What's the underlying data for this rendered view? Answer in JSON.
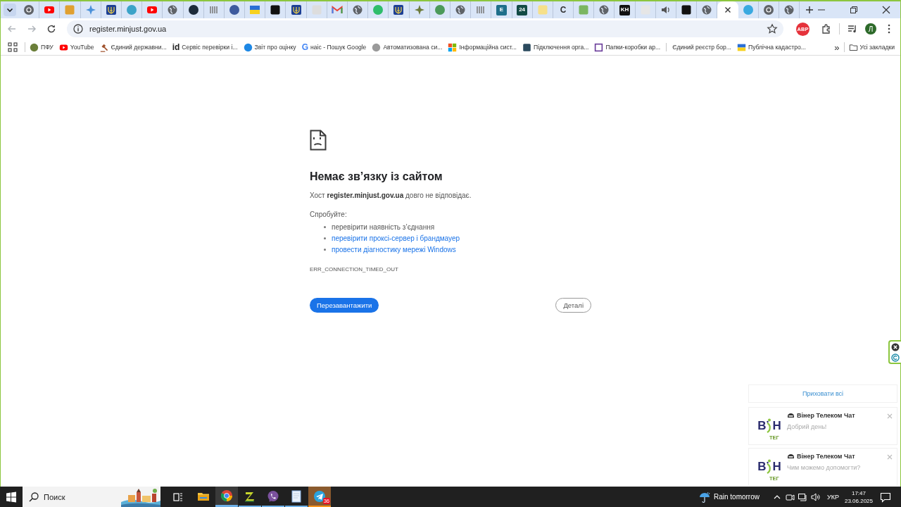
{
  "tab_strip": {
    "tabs": [
      {
        "kind": "chrome",
        "selected": false
      },
      {
        "kind": "youtube",
        "selected": false
      },
      {
        "kind": "square",
        "color": "#e0a030",
        "selected": false
      },
      {
        "kind": "star",
        "color": "#4a90d9",
        "selected": false
      },
      {
        "kind": "trident",
        "selected": false
      },
      {
        "kind": "circle",
        "color": "#3ba3c8",
        "selected": false
      },
      {
        "kind": "youtube",
        "selected": false
      },
      {
        "kind": "globe",
        "selected": false
      },
      {
        "kind": "circle",
        "color": "#1c2b3a",
        "selected": false
      },
      {
        "kind": "bars",
        "selected": false
      },
      {
        "kind": "circle",
        "color": "#3d5a9e",
        "selected": false
      },
      {
        "kind": "flag",
        "selected": false
      },
      {
        "kind": "square",
        "color": "#111111",
        "selected": false
      },
      {
        "kind": "trident",
        "selected": false
      },
      {
        "kind": "square",
        "color": "#dddddd",
        "selected": false
      },
      {
        "kind": "gmail",
        "selected": false
      },
      {
        "kind": "globe",
        "selected": false
      },
      {
        "kind": "circle",
        "color": "#2ebd6b",
        "selected": false
      },
      {
        "kind": "trident",
        "selected": false
      },
      {
        "kind": "star",
        "color": "#6b7a3a",
        "selected": false
      },
      {
        "kind": "circle",
        "color": "#4c9a5a",
        "selected": false
      },
      {
        "kind": "globe",
        "selected": false
      },
      {
        "kind": "bars",
        "selected": false
      },
      {
        "kind": "letter",
        "glyph": "E",
        "color": "#1f6f8b",
        "selected": false
      },
      {
        "kind": "letter",
        "glyph": "24",
        "color": "#124b45",
        "selected": false
      },
      {
        "kind": "square",
        "color": "#f6e08a",
        "selected": false
      },
      {
        "kind": "plain",
        "glyph": "C",
        "color": "#333333",
        "selected": false
      },
      {
        "kind": "square",
        "color": "#7bb661",
        "selected": false
      },
      {
        "kind": "globe",
        "selected": false
      },
      {
        "kind": "letter",
        "glyph": "KH",
        "color": "#111111",
        "selected": false
      },
      {
        "kind": "square",
        "color": "#e6e6e6",
        "selected": false
      },
      {
        "kind": "volume",
        "selected": false
      },
      {
        "kind": "square",
        "color": "#111111",
        "selected": false
      },
      {
        "kind": "globe",
        "selected": false
      },
      {
        "kind": "close",
        "selected": true
      },
      {
        "kind": "circle",
        "color": "#39a9e0",
        "selected": false
      },
      {
        "kind": "chrome",
        "selected": false
      },
      {
        "kind": "globe",
        "selected": false
      }
    ]
  },
  "toolbar": {
    "back_disabled": true,
    "forward_disabled": true,
    "url": "register.minjust.gov.ua",
    "adblock_label": "ABP",
    "avatar": "Л"
  },
  "bookmarks": [
    {
      "label": "ПФУ",
      "kind": "circle",
      "color": "#6b7f3a"
    },
    {
      "label": "YouTube",
      "kind": "youtube"
    },
    {
      "label": "Єдиний державни...",
      "kind": "gavel"
    },
    {
      "label": "Сервіс перевірки і...",
      "kind": "plain",
      "glyph": "id",
      "color": "#222222"
    },
    {
      "label": "Звіт про оцінку",
      "kind": "circle",
      "color": "#1e88e5"
    },
    {
      "label": "наіс - Пошук Google",
      "kind": "plain",
      "glyph": "G",
      "color": "#4285f4"
    },
    {
      "label": "Автоматизована си...",
      "kind": "circle",
      "color": "#9a9a9a"
    },
    {
      "label": "Інформаційна сист...",
      "kind": "tiles"
    },
    {
      "label": "Підключення орга...",
      "kind": "square",
      "color": "#2b4a5e"
    },
    {
      "label": "Папки-коробки ар...",
      "kind": "outline",
      "color": "#6a3d9a"
    },
    {
      "label": "Єдиний реєстр бор...",
      "kind": "separator"
    },
    {
      "label": "Публічна кадастро...",
      "kind": "flag"
    }
  ],
  "bookmarks_more": "»",
  "all_bookmarks": "Усі закладки",
  "error_page": {
    "title": "Немає зв’язку із сайтом",
    "message": "Хост **register.minjust.gov.ua** довго не відповідає.",
    "suggest_heading": "Спробуйте:",
    "suggestions": [
      {
        "text": "перевірити наявність з’єднання",
        "kind": "text"
      },
      {
        "text": "перевірити проксі-сервер і брандмауер",
        "kind": "link"
      },
      {
        "text": "провести діагностику мережі Windows",
        "kind": "link"
      }
    ],
    "error_code": "ERR_CONNECTION_TIMED_OUT",
    "reload_button": "Перезавантажити",
    "details_button": "Деталі"
  },
  "notifications": {
    "hide_all": "Приховати всі",
    "items": [
      {
        "title": "Вінер Телеком Чат",
        "message": "Добрий день!",
        "logo_left": "В",
        "logo_right": "Н",
        "logo_sub": "ТЕГ"
      },
      {
        "title": "Вінер Телеком Чат",
        "message": "Чим можемо допомогти?",
        "logo_left": "В",
        "logo_right": "Н",
        "logo_sub": "ТЕГ"
      }
    ]
  },
  "taskbar": {
    "search_placeholder": "Поиск",
    "apps": [
      {
        "kind": "folder",
        "selected": false,
        "running": false
      },
      {
        "kind": "chrome",
        "selected": true,
        "running": true
      },
      {
        "kind": "zapp",
        "selected": false,
        "running": true
      },
      {
        "kind": "viber",
        "selected": false,
        "running": true
      },
      {
        "kind": "notepad",
        "selected": false,
        "running": true
      },
      {
        "kind": "telegram",
        "selected": false,
        "running": true,
        "attention": true,
        "badge": "36"
      }
    ],
    "weather": "Rain tomorrow",
    "language": "УКР",
    "time": "17:47",
    "date": "23.06.2025"
  }
}
